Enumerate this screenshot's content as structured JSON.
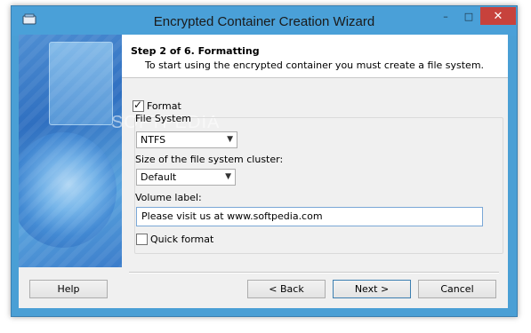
{
  "window": {
    "title": "Encrypted Container Creation Wizard",
    "controls": {
      "minimize": "–",
      "maximize": "□",
      "close": "✕"
    }
  },
  "header": {
    "step_title": "Step 2 of 6. Formatting",
    "step_description": "To start using the encrypted container you must create a file system."
  },
  "watermark": "SOFTPEDIA",
  "form": {
    "format": {
      "label": "Format",
      "checked": true
    },
    "file_system": {
      "label": "File System",
      "value": "NTFS"
    },
    "cluster_size": {
      "label": "Size of the file system cluster:",
      "value": "Default"
    },
    "volume_label": {
      "label": "Volume label:",
      "value": "Please visit us at www.softpedia.com"
    },
    "quick_format": {
      "label": "Quick format",
      "checked": false
    }
  },
  "buttons": {
    "help": "Help",
    "back": "< Back",
    "next": "Next >",
    "cancel": "Cancel"
  },
  "colors": {
    "titlebar": "#4aa0d8",
    "close_button": "#c7423c",
    "dialog_background": "#f0f0f0"
  }
}
